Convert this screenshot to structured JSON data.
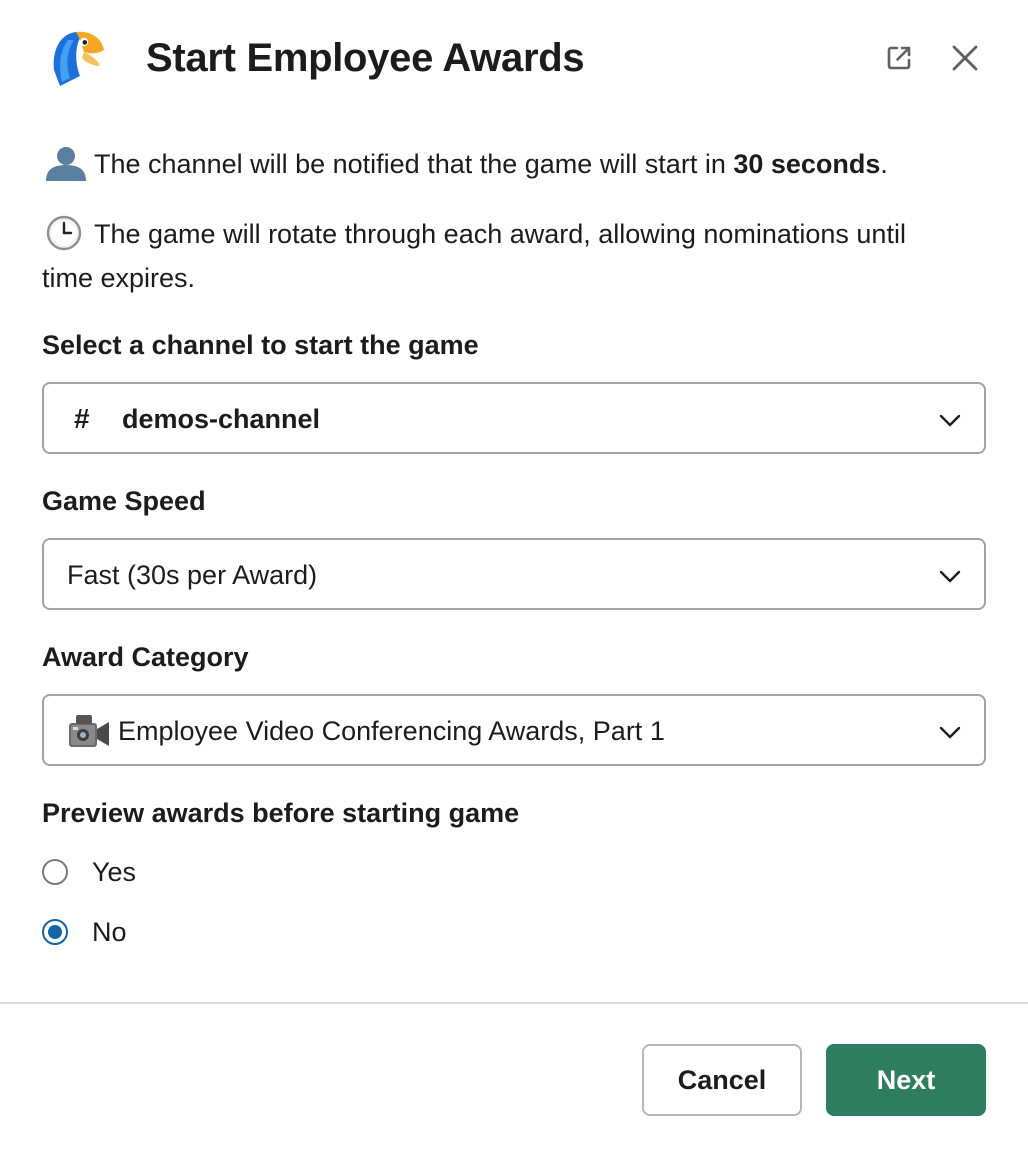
{
  "modal": {
    "title": "Start Employee Awards",
    "icons": {
      "logo": "parrot-logo-icon",
      "popout": "external-link-icon",
      "close": "close-icon"
    }
  },
  "info": {
    "line1_emoji": "bust-in-silhouette-icon",
    "line1_prefix": "The channel will be notified that the game will start in ",
    "line1_bold": "30 seconds",
    "line1_suffix": ".",
    "line2_emoji": "clock-icon",
    "line2_text": "The game will rotate through each award, allowing nominations until time expires."
  },
  "fields": {
    "channel": {
      "label": "Select a channel to start the game",
      "prefix": "#",
      "value": "demos-channel"
    },
    "speed": {
      "label": "Game Speed",
      "value": "Fast (30s per Award)"
    },
    "category": {
      "label": "Award Category",
      "emoji": "video-camera-icon",
      "value": "Employee Video Conferencing Awards, Part 1"
    },
    "preview": {
      "label": "Preview awards before starting game",
      "options": [
        {
          "label": "Yes",
          "checked": false
        },
        {
          "label": "No",
          "checked": true
        }
      ]
    }
  },
  "footer": {
    "cancel_label": "Cancel",
    "next_label": "Next"
  },
  "colors": {
    "primary": "#2f7d5f",
    "radio_selected": "#1264a3",
    "text": "#1d1c1d",
    "border": "#a3a3a6"
  }
}
